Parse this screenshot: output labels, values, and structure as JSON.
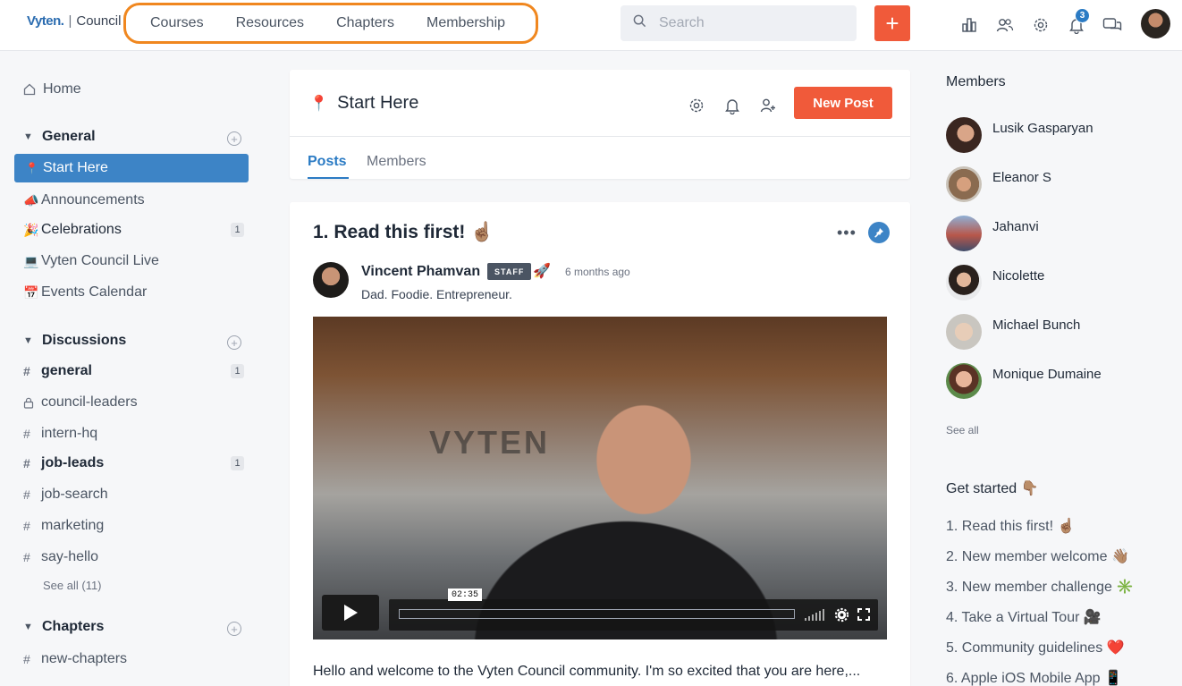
{
  "header": {
    "brand": "Vyten.",
    "sep": "|",
    "community": "Council",
    "nav": [
      "Courses",
      "Resources",
      "Chapters",
      "Membership"
    ],
    "search_placeholder": "Search",
    "plus_label": "+",
    "notification_count": "3"
  },
  "sidebar": {
    "home": "Home",
    "general": {
      "title": "General",
      "items": [
        {
          "emoji": "📍",
          "label": "Start Here"
        },
        {
          "emoji": "📣",
          "label": "Announcements"
        },
        {
          "emoji": "🎉",
          "label": "Celebrations",
          "count": "1"
        },
        {
          "emoji": "💻",
          "label": "Vyten Council Live"
        },
        {
          "emoji": "📅",
          "label": "Events Calendar"
        }
      ]
    },
    "discussions": {
      "title": "Discussions",
      "items": [
        {
          "label": "general",
          "count": "1"
        },
        {
          "label": "council-leaders"
        },
        {
          "label": "intern-hq"
        },
        {
          "label": "job-leads",
          "count": "1"
        },
        {
          "label": "job-search"
        },
        {
          "label": "marketing"
        },
        {
          "label": "say-hello"
        }
      ],
      "see_all": "See all (11)"
    },
    "chapters": {
      "title": "Chapters",
      "items": [
        {
          "label": "new-chapters"
        }
      ]
    }
  },
  "space": {
    "emoji": "📍",
    "title": "Start Here",
    "new_post": "New Post",
    "tabs": [
      "Posts",
      "Members"
    ]
  },
  "post": {
    "title": "1. Read this first! ☝🏽",
    "author": "Vincent Phamvan",
    "badge": "STAFF",
    "badge_emoji": "🚀",
    "time": "6 months ago",
    "bio": "Dad. Foodie. Entrepreneur.",
    "video_brand": "VYTEN",
    "video_time": "02:35",
    "body": "Hello and welcome to the Vyten Council community. I'm so excited that you are here,..."
  },
  "members": {
    "title": "Members",
    "list": [
      "Lusik Gasparyan",
      "Eleanor S",
      "Jahanvi",
      "Nicolette",
      "Michael Bunch",
      "Monique Dumaine"
    ],
    "see_all": "See all"
  },
  "get_started": {
    "title": "Get started 👇🏽",
    "items": [
      "1. Read this first! ☝🏽",
      "2. New member welcome 👋🏽",
      "3. New member challenge ✳️",
      "4. Take a Virtual Tour 🎥",
      "5. Community guidelines ❤️",
      "6. Apple iOS Mobile App 📱"
    ]
  },
  "colors": {
    "accent": "#f05a3a",
    "primary": "#3d84c6",
    "highlight": "#f0871f"
  }
}
